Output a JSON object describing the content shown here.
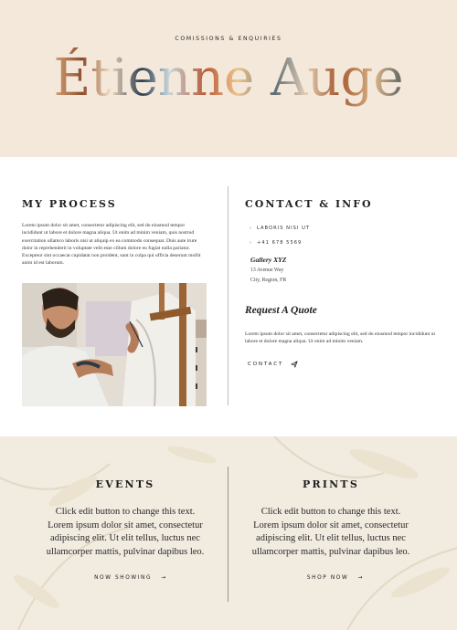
{
  "hero": {
    "kicker": "COMISSIONS & ENQUIRIES",
    "title": "Étienne Auge"
  },
  "process": {
    "heading": "MY PROCESS",
    "body": "Lorem ipsum dolor sit amet, consectetur adipiscing elit, sed do eiusmod tempor incididunt ut labore et dolore magna aliqua. Ut enim ad minim veniam, quis nostrud exercitation ullamco laboris nisi ut aliquip ex ea commodo consequat. Duis aute irure dolor in reprehenderit in voluptate velit esse cillum dolore eu fugiat nulla pariatur. Excepteur sint occaecat cupidatat non proident, sunt in culpa qui officia deserunt mollit anim id est laborum."
  },
  "contact": {
    "heading": "CONTACT & INFO",
    "items": [
      {
        "icon": "chevron-right-icon",
        "label": "LABORIS NISI UT"
      },
      {
        "icon": "chevron-right-icon",
        "label": "+41 678 5569"
      }
    ],
    "gallery_name": "Gallery XYZ",
    "address_line1": "13 Avenue Way",
    "address_line2": "City, Region, FR",
    "quote_title": "Request A Quote",
    "quote_body": "Lorem ipsum dolor sit amet, consectetur adipiscing elit, sed do eiusmod tempor incididunt ut labore et dolore magna aliqua. Ut enim ad minim veniam.",
    "button_label": "CONTACT",
    "button_icon": "paper-plane-icon"
  },
  "events": {
    "heading": "EVENTS",
    "body": "Click edit button to change this text. Lorem ipsum dolor sit amet, consectetur adipiscing elit. Ut elit tellus, luctus nec ullamcorper mattis, pulvinar dapibus leo.",
    "link": "NOW SHOWING",
    "link_icon": "arrow-right-icon"
  },
  "prints": {
    "heading": "PRINTS",
    "body": "Click edit button to change this text. Lorem ipsum dolor sit amet, consectetur adipiscing elit. Ut elit tellus, luctus nec ullamcorper mattis, pulvinar dapibus leo.",
    "link": "SHOP NOW",
    "link_icon": "arrow-right-icon"
  },
  "colors": {
    "hero_bg": "#f3e8da",
    "bottom_bg": "#f1ebe0",
    "text": "#222222"
  }
}
